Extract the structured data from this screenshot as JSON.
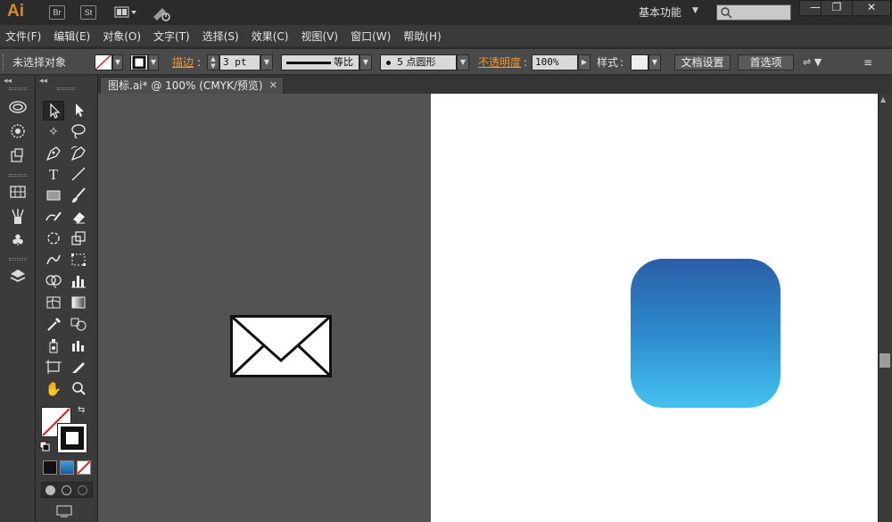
{
  "titlebar": {
    "app_logo": "Ai",
    "bridge_label": "Br",
    "stock_label": "St",
    "workspace": "基本功能",
    "search_placeholder": "",
    "minimize": "—",
    "restore": "❐",
    "close": "✕"
  },
  "menu": [
    "文件(F)",
    "编辑(E)",
    "对象(O)",
    "文字(T)",
    "选择(S)",
    "效果(C)",
    "视图(V)",
    "窗口(W)",
    "帮助(H)"
  ],
  "control": {
    "selection_status": "未选择对象",
    "stroke_label": "描边",
    "stroke_weight": "3 pt",
    "stroke_profile": "等比",
    "brush_label": "5 点圆形",
    "opacity_label": "不透明度",
    "opacity_value": "100%",
    "style_label": "样式",
    "doc_setup": "文档设置",
    "preferences": "首选项"
  },
  "document": {
    "tab_title": "图标.ai* @ 100% (CMYK/预览)",
    "color_mode": "CMYK",
    "zoom": "100%"
  },
  "colors": {
    "icon_gradient_top": "#2a5ea7",
    "icon_gradient_bottom": "#44c2f0",
    "stroke_accent": "#f0962f",
    "artboard": "#ffffff",
    "pasteboard": "#535353"
  },
  "icons": {
    "dock": [
      "creative-cloud-icon",
      "color-wheel-icon",
      "transform-icon",
      "grid-icon",
      "brush-library-icon",
      "symbols-club-icon",
      "layers-icon"
    ],
    "tools": [
      "selection-tool",
      "direct-selection-tool",
      "magic-wand-tool",
      "lasso-tool",
      "pen-tool",
      "curvature-tool",
      "type-tool",
      "line-tool",
      "rectangle-tool",
      "paintbrush-tool",
      "shaper-tool",
      "eraser-tool",
      "rotate-tool",
      "scale-tool",
      "warp-tool",
      "free-transform-tool",
      "shape-builder-tool",
      "graph-tool",
      "mesh-tool",
      "gradient-tool",
      "eyedropper-tool",
      "blend-tool",
      "symbol-sprayer-tool",
      "column-graph-tool",
      "artboard-tool",
      "slice-tool",
      "hand-tool",
      "zoom-tool"
    ]
  }
}
